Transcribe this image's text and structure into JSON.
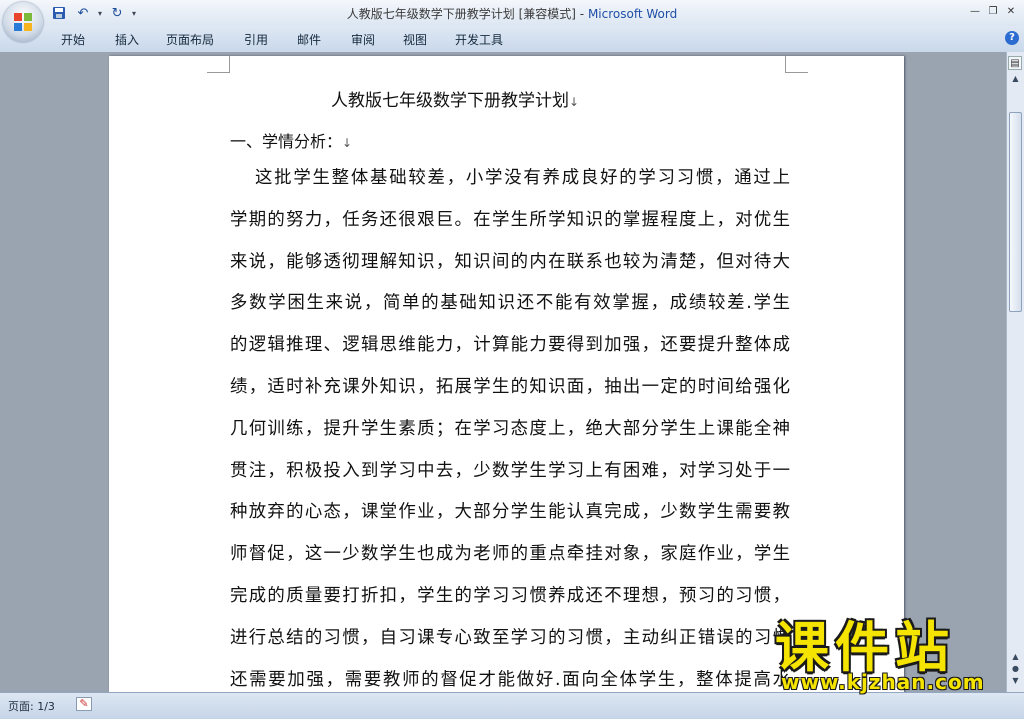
{
  "window": {
    "title_doc": "人教版七年级数学下册教学计划 [兼容模式]",
    "title_sep": " - ",
    "title_app": "Microsoft Word"
  },
  "qat": {
    "save_icon": "save-icon",
    "undo_icon": "undo-icon",
    "redo_icon": "redo-icon",
    "customize_icon": "customize-qat-icon"
  },
  "ribbon": {
    "tabs": [
      "开始",
      "插入",
      "页面布局",
      "引用",
      "邮件",
      "审阅",
      "视图",
      "开发工具"
    ]
  },
  "document": {
    "title": "人教版七年级数学下册教学计划",
    "heading": "一、学情分析：",
    "paragraph_mark": "↓",
    "lines": [
      "这批学生整体基础较差，小学没有养成良好的学习习惯，通过上",
      "学期的努力，任务还很艰巨。在学生所学知识的掌握程度上，对优生",
      "来说，能够透彻理解知识，知识间的内在联系也较为清楚，但对待大",
      "多数学困生来说，简单的基础知识还不能有效掌握，成绩较差.学生",
      "的逻辑推理、逻辑思维能力，计算能力要得到加强，还要提升整体成",
      "绩，适时补充课外知识，拓展学生的知识面，抽出一定的时间给强化",
      "几何训练，提升学生素质；在学习态度上，绝大部分学生上课能全神",
      "贯注，积极投入到学习中去，少数学生学习上有困难，对学习处于一",
      "种放弃的心态，课堂作业，大部分学生能认真完成，少数学生需要教",
      "师督促，这一少数学生也成为老师的重点牵挂对象，家庭作业，学生",
      "完成的质量要打折扣，学生的学习习惯养成还不理想，预习的习惯，",
      "进行总结的习惯，自习课专心致至学习的习惯，主动纠正错误的习惯",
      "还需要加强，需要教师的督促才能做好.面向全体学生，整体提高水"
    ]
  },
  "statusbar": {
    "pages": "页面: 1/3"
  },
  "watermark": {
    "brand": "课件站",
    "url": "www.kjzhan.com"
  }
}
